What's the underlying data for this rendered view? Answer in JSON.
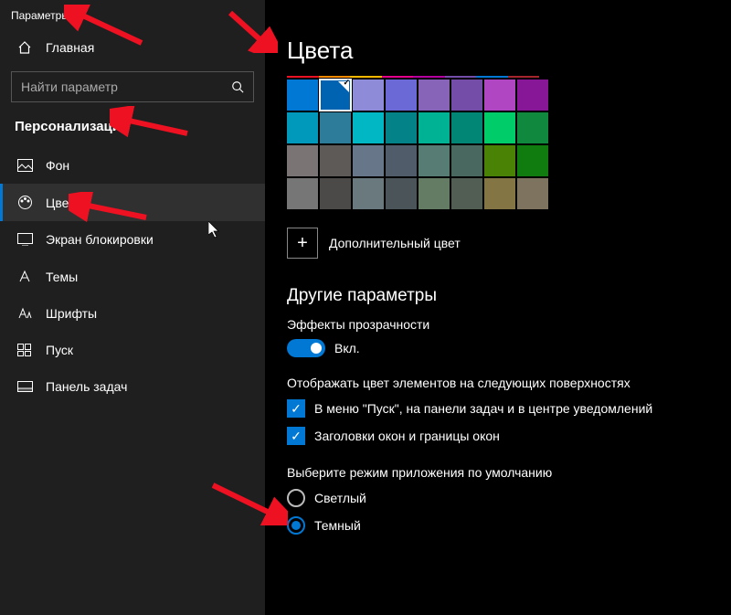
{
  "window_title": "Параметры",
  "sidebar": {
    "home": "Главная",
    "search_placeholder": "Найти параметр",
    "section": "Персонализация",
    "items": [
      {
        "label": "Фон"
      },
      {
        "label": "Цвета"
      },
      {
        "label": "Экран блокировки"
      },
      {
        "label": "Темы"
      },
      {
        "label": "Шрифты"
      },
      {
        "label": "Пуск"
      },
      {
        "label": "Панель задач"
      }
    ]
  },
  "content": {
    "heading": "Цвета",
    "accent_colors": [
      "#e81123",
      "#ff8c00",
      "#ffb700",
      "#e3008c",
      "#b4009e",
      "#744da9",
      "#0078d4",
      "#a4262c"
    ],
    "grid": [
      [
        "#0078d4",
        "#0063b1",
        "#8e8cd8",
        "#6b69d6",
        "#8764b8",
        "#744da9",
        "#b146c2",
        "#881798"
      ],
      [
        "#0099bc",
        "#2d7d9a",
        "#00b7c3",
        "#038387",
        "#00b294",
        "#018574",
        "#00cc6a",
        "#10893e"
      ],
      [
        "#7a7574",
        "#5d5a58",
        "#68768a",
        "#515c6b",
        "#567c73",
        "#486860",
        "#498205",
        "#107c10"
      ],
      [
        "#767676",
        "#4c4a48",
        "#69797e",
        "#4a5459",
        "#647c64",
        "#525e54",
        "#847545",
        "#7e735f"
      ]
    ],
    "selected_color_index": [
      0,
      1
    ],
    "more_color": "Дополнительный цвет",
    "other_heading": "Другие параметры",
    "transparency_label": "Эффекты прозрачности",
    "toggle_on": "Вкл.",
    "surfaces_label": "Отображать цвет элементов на следующих поверхностях",
    "surfaces": [
      "В меню \"Пуск\", на панели задач и в центре уведомлений",
      "Заголовки окон и границы окон"
    ],
    "app_mode_label": "Выберите режим приложения по умолчанию",
    "app_modes": [
      {
        "label": "Светлый",
        "checked": false
      },
      {
        "label": "Темный",
        "checked": true
      }
    ]
  }
}
